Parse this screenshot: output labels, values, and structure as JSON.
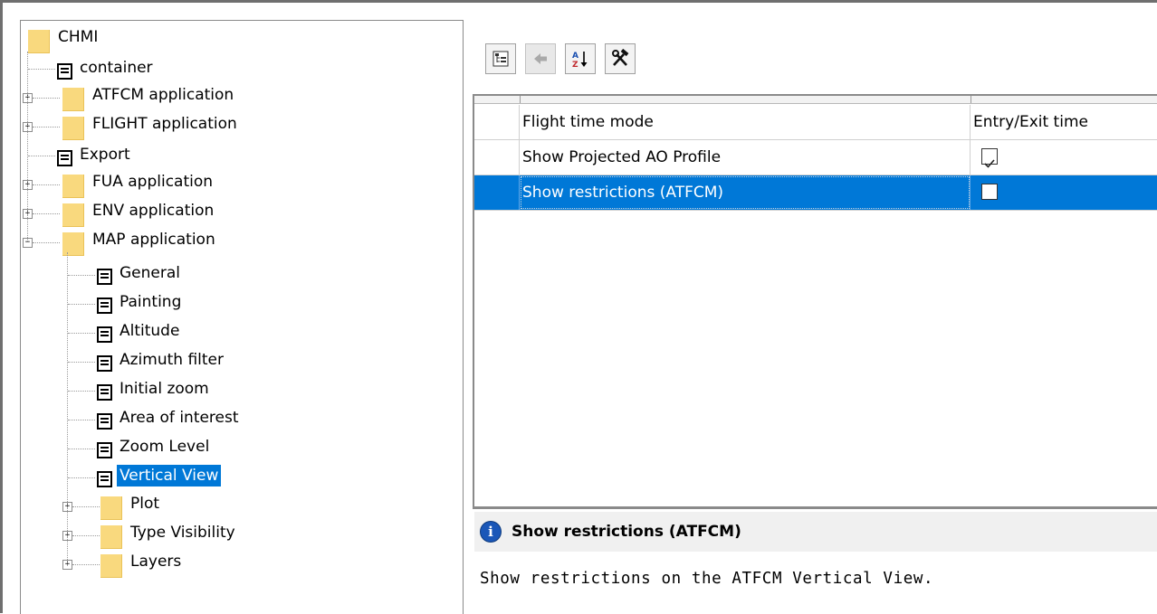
{
  "tree": {
    "root": "CHMI",
    "items": [
      {
        "label": "container",
        "type": "doc"
      },
      {
        "label": "ATFCM application",
        "type": "folder",
        "expander": "+"
      },
      {
        "label": "FLIGHT application",
        "type": "folder",
        "expander": "+"
      },
      {
        "label": "Export",
        "type": "doc"
      },
      {
        "label": "FUA application",
        "type": "folder",
        "expander": "+"
      },
      {
        "label": "ENV application",
        "type": "folder",
        "expander": "+"
      },
      {
        "label": "MAP application",
        "type": "folder",
        "expander": "−"
      }
    ],
    "map_children": [
      {
        "label": "General",
        "type": "doc"
      },
      {
        "label": "Painting",
        "type": "doc"
      },
      {
        "label": "Altitude",
        "type": "doc"
      },
      {
        "label": "Azimuth filter",
        "type": "doc"
      },
      {
        "label": "Initial zoom",
        "type": "doc"
      },
      {
        "label": "Area of interest",
        "type": "doc"
      },
      {
        "label": "Zoom Level",
        "type": "doc"
      },
      {
        "label": "Vertical View",
        "type": "doc",
        "selected": true
      },
      {
        "label": "Plot",
        "type": "folder",
        "expander": "+"
      },
      {
        "label": "Type Visibility",
        "type": "folder",
        "expander": "+"
      },
      {
        "label": "Layers",
        "type": "folder",
        "expander": "+"
      }
    ]
  },
  "toolbar": {
    "buttons": [
      {
        "icon": "categorized-view-icon",
        "enabled": true
      },
      {
        "icon": "back-arrow-icon",
        "enabled": false
      },
      {
        "icon": "sort-az-icon",
        "enabled": true
      },
      {
        "icon": "tools-icon",
        "enabled": true
      }
    ]
  },
  "table": {
    "rows": [
      {
        "name": "Flight time mode",
        "value": "Entry/Exit time",
        "kind": "text",
        "selected": false
      },
      {
        "name": "Show Projected AO Profile",
        "value": "",
        "kind": "checkbox",
        "checked": true,
        "selected": false
      },
      {
        "name": "Show restrictions (ATFCM)",
        "value": "",
        "kind": "checkbox",
        "checked": false,
        "selected": true
      }
    ]
  },
  "info": {
    "title": "Show restrictions (ATFCM)",
    "icon_glyph": "i",
    "description": "Show restrictions on the ATFCM Vertical View."
  },
  "colors": {
    "selection": "#0078d7",
    "folder": "#f9d97e"
  }
}
